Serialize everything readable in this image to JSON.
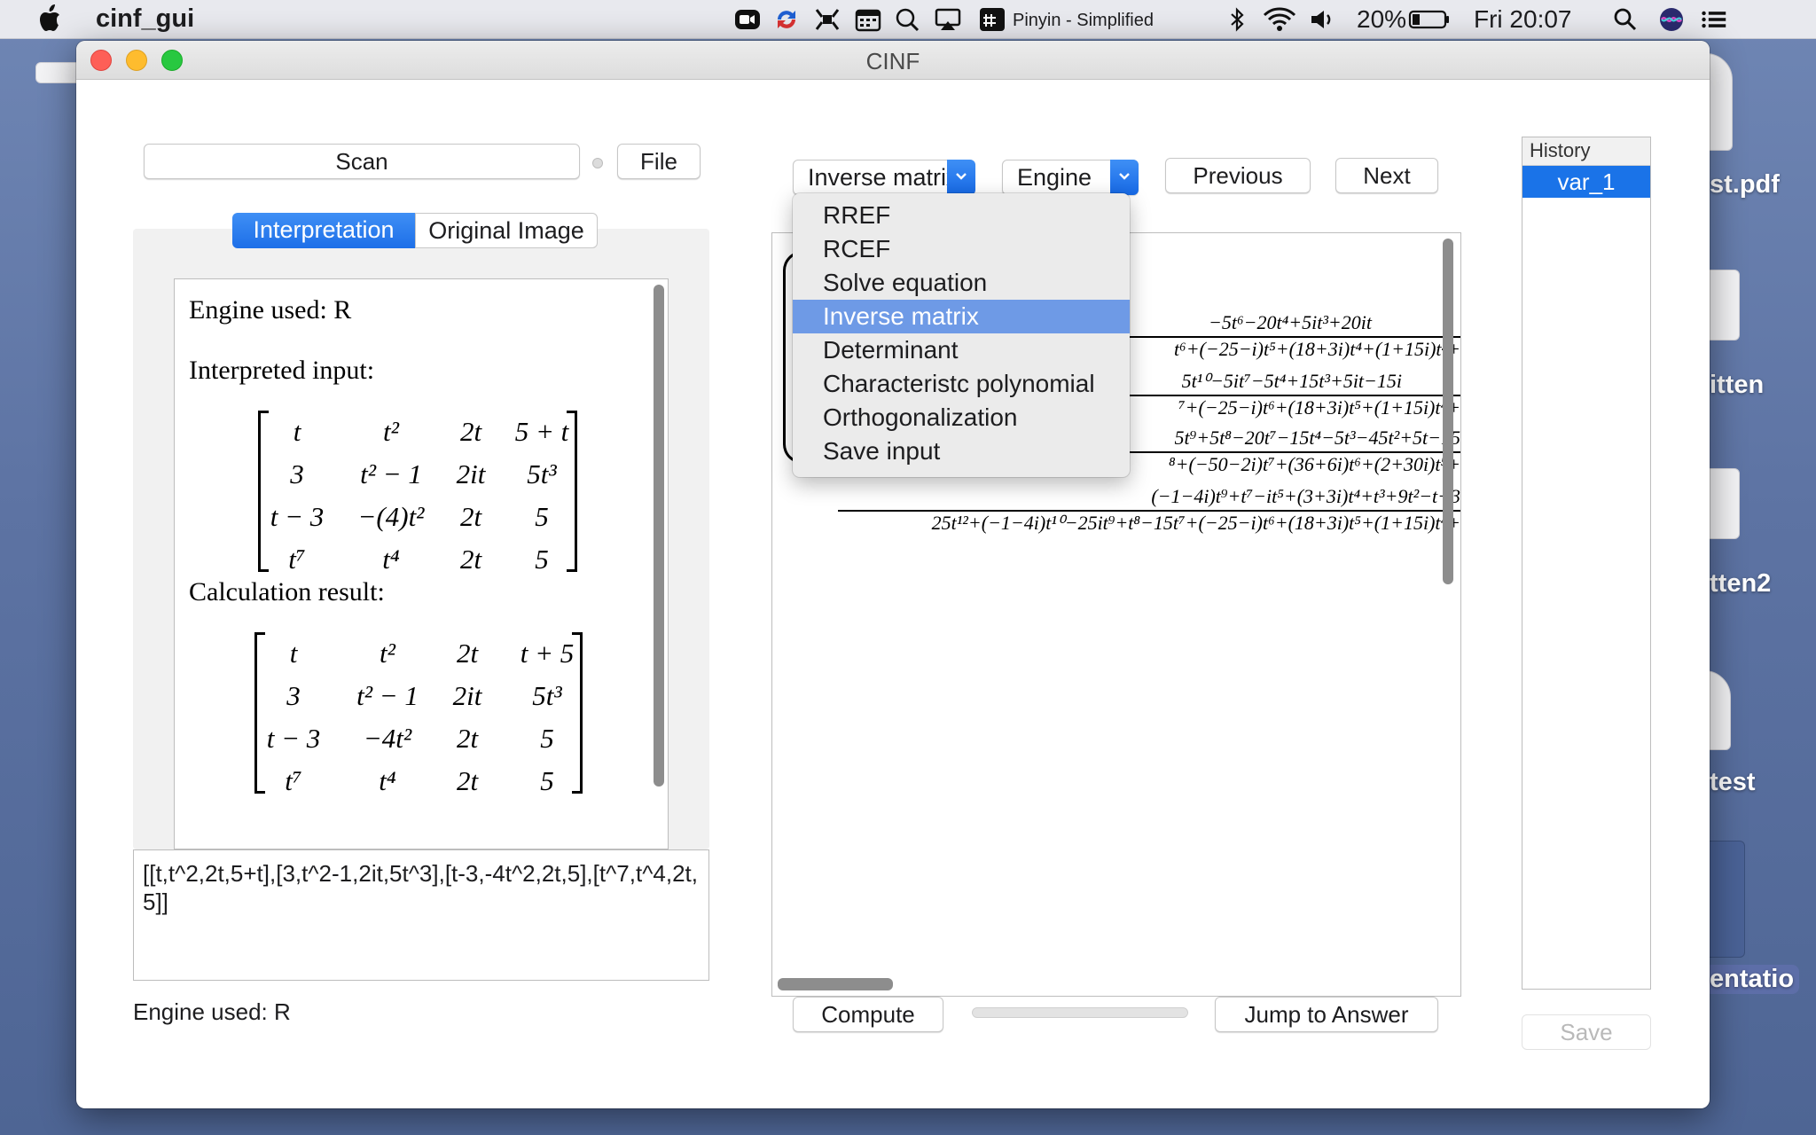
{
  "menubar": {
    "app_name": "cinf_gui",
    "input_method": "Pinyin - Simplified",
    "battery": "20%",
    "clock": "Fri 20:07"
  },
  "desktop": {
    "labels": [
      "st.pdf",
      "itten",
      "tten2",
      "test",
      "entatio"
    ]
  },
  "window": {
    "title": "CINF",
    "scan_label": "Scan",
    "file_label": "File",
    "tabs": [
      "Interpretation",
      "Original Image"
    ],
    "interpretation": {
      "engine_line": "Engine used: R",
      "interpreted_heading": "Interpreted input:",
      "input_matrix": [
        [
          "t",
          "t²",
          "2t",
          "5 + t"
        ],
        [
          "3",
          "t² − 1",
          "2it",
          "5t³"
        ],
        [
          "t − 3",
          "−(4)t²",
          "2t",
          "5"
        ],
        [
          "t⁷",
          "t⁴",
          "2t",
          "5"
        ]
      ],
      "result_heading": "Calculation result:",
      "result_matrix": [
        [
          "t",
          "t²",
          "2t",
          "t + 5"
        ],
        [
          "3",
          "t² − 1",
          "2it",
          "5t³"
        ],
        [
          "t − 3",
          "−4t²",
          "2t",
          "5"
        ],
        [
          "t⁷",
          "t⁴",
          "2t",
          "5"
        ]
      ]
    },
    "input_text": "[[t,t^2,2t,5+t],[3,t^2-1,2it,5t^3],[t-3,-4t^2,2t,5],[t^7,t^4,2t,5]]",
    "engine_status": "Engine used: R",
    "operation_select": "Inverse matrix",
    "engine_select": "Engine",
    "previous_label": "Previous",
    "next_label": "Next",
    "operation_options": [
      "RREF",
      "RCEF",
      "Solve equation",
      "Inverse matrix",
      "Determinant",
      "Characteristc polynomial",
      "Orthogonalization",
      "Save input"
    ],
    "selected_option": "Inverse matrix",
    "result_fractions": [
      {
        "num": "−5t⁶−20t⁴+5it³+20it",
        "den": "t⁶+(−25−i)t⁵+(18+3i)t⁴+(1+15i)t³+"
      },
      {
        "num": "5t¹⁰−5it⁷−5t⁴+15t³+5it−15i",
        "den": "⁷+(−25−i)t⁶+(18+3i)t⁵+(1+15i)t⁴+"
      },
      {
        "num": "5t⁹+5t⁸−20t⁷−15t⁴−5t³−45t²+5t−15",
        "den": "⁸+(−50−2i)t⁷+(36+6i)t⁶+(2+30i)t⁵+"
      },
      {
        "num": "(−1−4i)t⁹+t⁷−it⁵+(3+3i)t⁴+t³+9t²−t+3",
        "den": "25t¹²+(−1−4i)t¹⁰−25it⁹+t⁸−15t⁷+(−25−i)t⁶+(18+3i)t⁵+(1+15i)t⁴+"
      }
    ],
    "compute_label": "Compute",
    "jump_label": "Jump to Answer",
    "history_title": "History",
    "history_items": [
      "var_1"
    ],
    "save_label": "Save"
  }
}
